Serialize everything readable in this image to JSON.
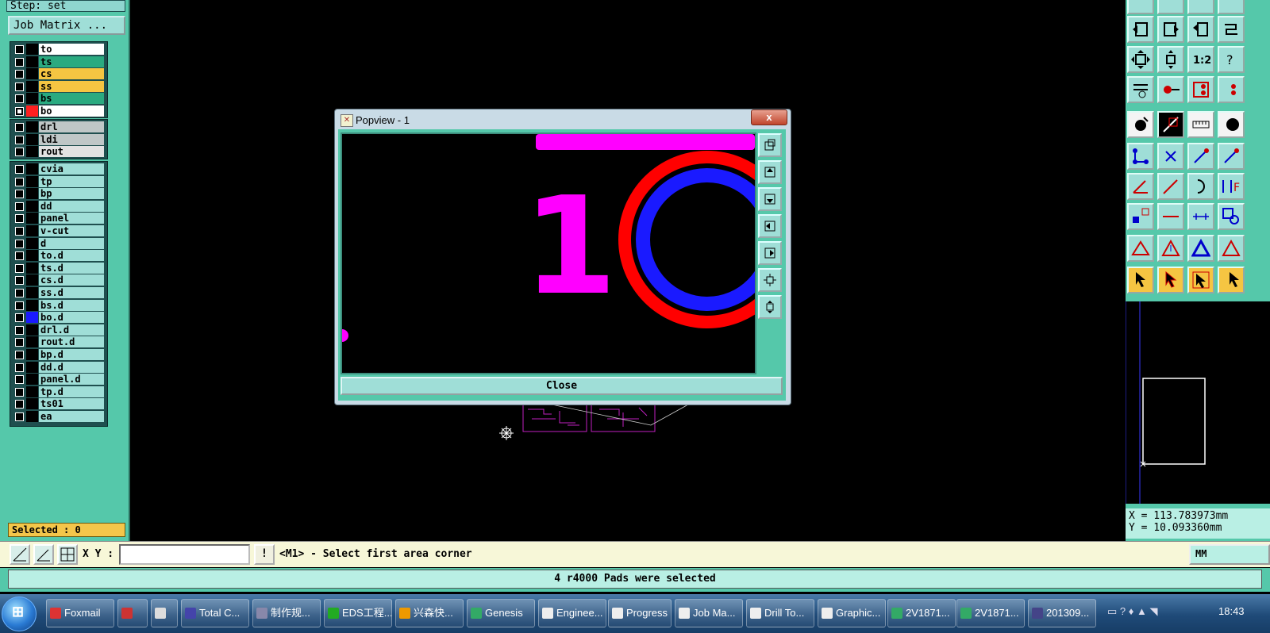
{
  "left_panel": {
    "step_label": "Step: set",
    "job_matrix_button": "Job Matrix ...",
    "layers_group1": [
      {
        "name": "to",
        "bg": "#ffffff",
        "checked": false
      },
      {
        "name": "ts",
        "bg": "#2aaa80",
        "checked": false
      },
      {
        "name": "cs",
        "bg": "#f5c542",
        "checked": false
      },
      {
        "name": "ss",
        "bg": "#f5c542",
        "checked": false
      },
      {
        "name": "bs",
        "bg": "#2aaa80",
        "checked": false
      },
      {
        "name": "bo",
        "bg": "#ffffff",
        "checked": true,
        "swatch": "#ff2020"
      }
    ],
    "layers_group2": [
      {
        "name": "drl",
        "bg": "#bfc7c7"
      },
      {
        "name": "ldi",
        "bg": "#bfc7c7"
      },
      {
        "name": "rout",
        "bg": "#e2e2e2"
      }
    ],
    "layers_group3": [
      {
        "name": "cvia"
      },
      {
        "name": "tp"
      },
      {
        "name": "bp"
      },
      {
        "name": "dd"
      },
      {
        "name": "panel"
      },
      {
        "name": "v-cut"
      },
      {
        "name": "d"
      },
      {
        "name": "to.d"
      },
      {
        "name": "ts.d"
      },
      {
        "name": "cs.d"
      },
      {
        "name": "ss.d"
      },
      {
        "name": "bs.d"
      },
      {
        "name": "bo.d",
        "swatch": "#1a1aff"
      },
      {
        "name": "drl.d"
      },
      {
        "name": "rout.d"
      },
      {
        "name": "bp.d"
      },
      {
        "name": "dd.d"
      },
      {
        "name": "panel.d"
      },
      {
        "name": "tp.d"
      },
      {
        "name": "ts01"
      },
      {
        "name": "ea"
      }
    ],
    "selected_text": "Selected : 0"
  },
  "popview": {
    "title": "Popview - 1",
    "title_icon": "x-app-icon",
    "close_x": "x",
    "close_button": "Close",
    "canvas_text": "1"
  },
  "command_bar": {
    "xy_label": "X Y :",
    "xy_value": "",
    "excl_label": "!",
    "prompt": "<M1> - Select first area corner",
    "unit": "MM"
  },
  "status_message": "4 r4000 Pads were selected",
  "coordinates": {
    "x": "X = 113.783973mm",
    "y": "Y = 10.093360mm"
  },
  "taskbar": {
    "items": [
      {
        "label": "Foxmail",
        "color": "#d33"
      },
      {
        "label": "",
        "color": "#c33"
      },
      {
        "label": "",
        "color": "#ddd"
      },
      {
        "label": "Total C...",
        "color": "#44a"
      },
      {
        "label": "制作规...",
        "color": "#88a"
      },
      {
        "label": "EDS工程...",
        "color": "#2a2"
      },
      {
        "label": "兴森快...",
        "color": "#e90"
      },
      {
        "label": "Genesis",
        "color": "#3a6"
      },
      {
        "label": "Enginee...",
        "color": "#eee"
      },
      {
        "label": "Progress",
        "color": "#eee"
      },
      {
        "label": "Job Ma...",
        "color": "#eee"
      },
      {
        "label": "Drill To...",
        "color": "#eee"
      },
      {
        "label": "Graphic...",
        "color": "#eee"
      },
      {
        "label": "2V1871...",
        "color": "#3a6"
      },
      {
        "label": "2V1871...",
        "color": "#3a6"
      },
      {
        "label": "201309...",
        "color": "#448"
      }
    ],
    "clock": "18:43"
  }
}
